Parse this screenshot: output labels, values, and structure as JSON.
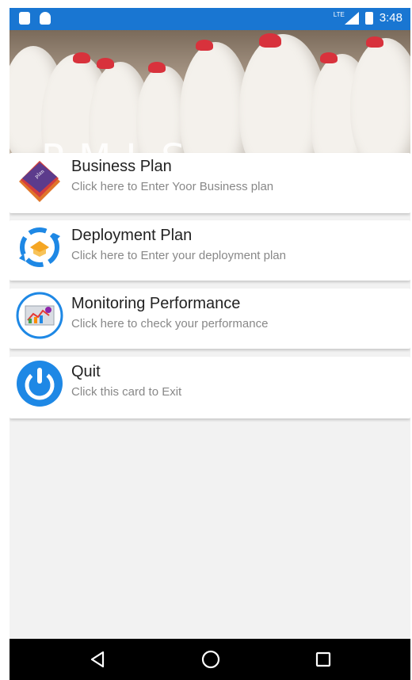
{
  "status_bar": {
    "network": "LTE",
    "time": "3:48"
  },
  "header": {
    "title": "PMLS"
  },
  "cards": [
    {
      "title": "Business Plan",
      "subtitle": "Click here to Enter Yoor Business plan",
      "icon": "business-plan-book-icon"
    },
    {
      "title": "Deployment Plan",
      "subtitle": "Click here to Enter your deployment plan",
      "icon": "deployment-cycle-icon"
    },
    {
      "title": "Monitoring Performance",
      "subtitle": "Click here to check your performance",
      "icon": "monitoring-chart-icon"
    },
    {
      "title": "Quit",
      "subtitle": "Click this card to Exit",
      "icon": "power-icon"
    }
  ],
  "nav": {
    "back": "back-triangle-icon",
    "home": "home-circle-icon",
    "recents": "recents-square-icon"
  },
  "colors": {
    "status_bar": "#1976d2",
    "icon_blue": "#1e88e5",
    "title_text": "#222222",
    "subtitle_text": "#888888"
  }
}
